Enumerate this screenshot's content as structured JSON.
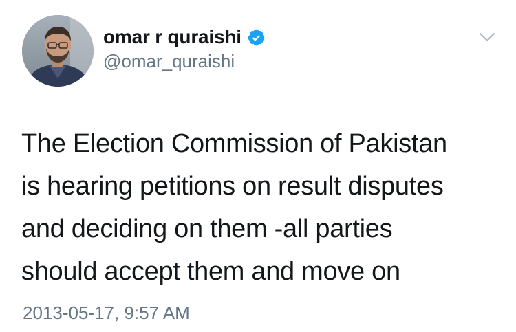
{
  "user": {
    "display_name": "omar r quraishi",
    "handle": "@omar_quraishi",
    "verified": true
  },
  "tweet": {
    "lines": [
      "The Election Commission of Pakistan",
      "is hearing petitions on result disputes",
      "and deciding on them -all parties",
      "should accept them and move on"
    ],
    "timestamp": "2013-05-17, 9:57 AM"
  },
  "icons": {
    "verified": "verified-badge-icon",
    "menu": "chevron-down-icon"
  },
  "colors": {
    "text_primary": "#14171a",
    "text_secondary": "#657786",
    "verified_blue": "#1da1f2",
    "chevron": "#aab8c2"
  }
}
